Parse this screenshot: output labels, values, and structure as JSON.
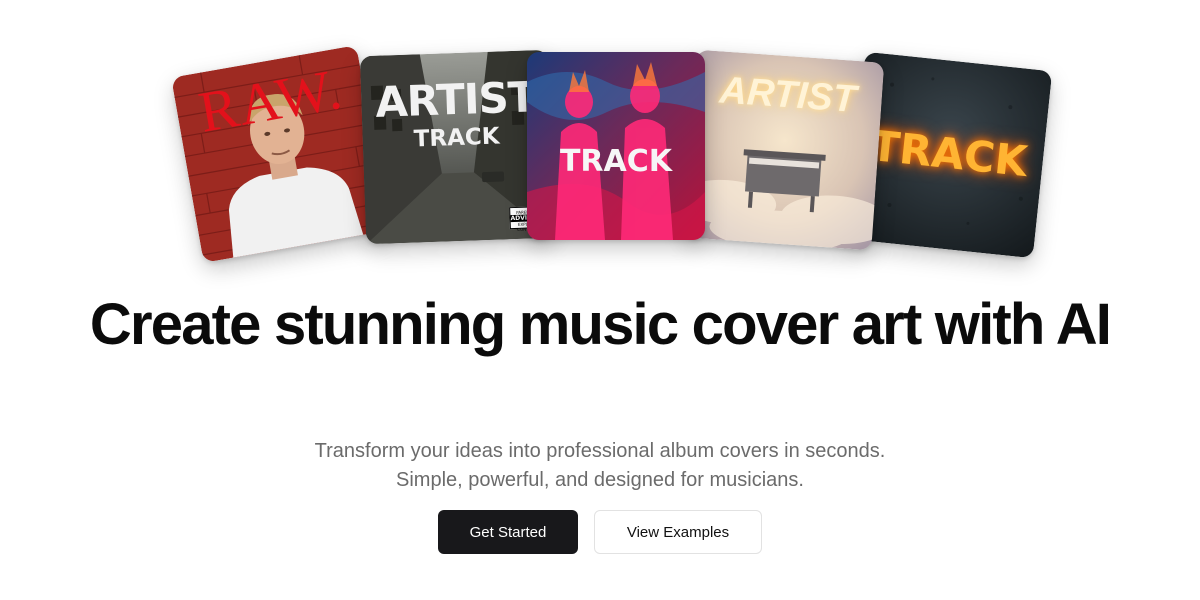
{
  "covers": [
    {
      "name": "raw-cover",
      "title": "RAW."
    },
    {
      "name": "artist-track-cover",
      "title": "ARTIST",
      "subtitle": "TRACK",
      "advisory": [
        "PARENTAL",
        "ADVISORY",
        "EXPLICIT CONTENT"
      ]
    },
    {
      "name": "track-neon-cover",
      "title": "TRACK"
    },
    {
      "name": "artist-piano-cover",
      "title": "ARTIST"
    },
    {
      "name": "track-fire-cover",
      "title": "TRACK"
    }
  ],
  "hero": {
    "headline": "Create stunning music cover art with AI",
    "subline_1": "Transform your ideas into professional album covers in seconds.",
    "subline_2": "Simple, powerful, and designed for musicians."
  },
  "actions": {
    "primary_label": "Get Started",
    "secondary_label": "View Examples"
  }
}
